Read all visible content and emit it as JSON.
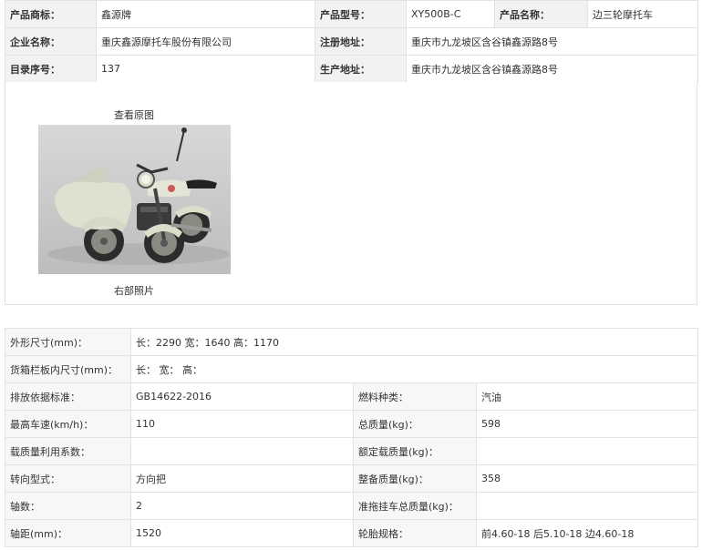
{
  "basic": {
    "rows": [
      [
        {
          "label": "产品商标：",
          "value": "鑫源牌"
        },
        {
          "label": "产品型号：",
          "value": "XY500B-C"
        },
        {
          "label": "产品名称：",
          "value": "边三轮摩托车"
        }
      ],
      [
        {
          "label": "企业名称：",
          "value": "重庆鑫源摩托车股份有限公司"
        },
        {
          "label": "注册地址：",
          "value": "重庆市九龙坡区含谷镇鑫源路8号"
        }
      ],
      [
        {
          "label": "目录序号：",
          "value": "137"
        },
        {
          "label": "生产地址：",
          "value": "重庆市九龙坡区含谷镇鑫源路8号"
        }
      ]
    ]
  },
  "photo": {
    "link_label": "查看原图",
    "caption": "右部照片"
  },
  "specs": {
    "dimensions": {
      "label": "外形尺寸(mm)：",
      "value": "长：2290 宽：1640 高：1170"
    },
    "cargo_box": {
      "label": "货箱栏板内尺寸(mm)：",
      "value": "长： 宽： 高："
    },
    "rows": [
      [
        {
          "label": "排放依据标准：",
          "value": "GB14622-2016"
        },
        {
          "label": "燃料种类：",
          "value": "汽油"
        }
      ],
      [
        {
          "label": "最高车速(km/h)：",
          "value": "110"
        },
        {
          "label": "总质量(kg)：",
          "value": "598"
        }
      ],
      [
        {
          "label": "载质量利用系数：",
          "value": ""
        },
        {
          "label": "额定载质量(kg)：",
          "value": ""
        }
      ],
      [
        {
          "label": "转向型式：",
          "value": "方向把"
        },
        {
          "label": "整备质量(kg)：",
          "value": "358"
        }
      ],
      [
        {
          "label": "轴数：",
          "value": "2"
        },
        {
          "label": "准拖挂车总质量(kg)：",
          "value": ""
        }
      ],
      [
        {
          "label": "轴距(mm)：",
          "value": "1520"
        },
        {
          "label": "轮胎规格：",
          "value": "前4.60-18 后5.10-18 边4.60-18"
        }
      ]
    ]
  }
}
